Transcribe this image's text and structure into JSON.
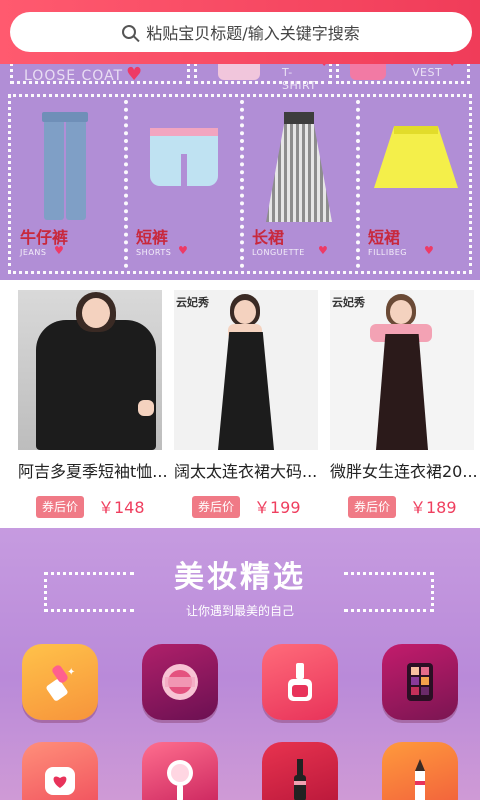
{
  "search": {
    "placeholder": "粘贴宝贝标题/输入关键字搜索"
  },
  "category_panel": {
    "top_items": [
      {
        "label": "LOOSE COAT"
      },
      {
        "label": "T-SHIRT"
      },
      {
        "label": "VEST"
      }
    ],
    "cells": [
      {
        "name": "牛仔裤",
        "en": "JEANS"
      },
      {
        "name": "短裤",
        "en": "SHORTS"
      },
      {
        "name": "长裙",
        "en": "LONGUETTE"
      },
      {
        "name": "短裙",
        "en": "FILLIBEG"
      }
    ]
  },
  "products": [
    {
      "title": "阿吉多夏季短袖t恤...",
      "badge": "券后价",
      "price": "￥148",
      "brand": ""
    },
    {
      "title": "阔太太连衣裙大码...",
      "badge": "券后价",
      "price": "￥199",
      "brand": "云妃秀"
    },
    {
      "title": "微胖女生连衣裙20...",
      "badge": "券后价",
      "price": "￥189",
      "brand": "云妃秀"
    }
  ],
  "beauty": {
    "title": "美妆精选",
    "subtitle": "让你遇到最美的自己",
    "icons": [
      {
        "icon": "lipstick-icon",
        "colors": [
          "#ffc24a",
          "#f7943b"
        ]
      },
      {
        "icon": "powder-compact-icon",
        "colors": [
          "#b0206a",
          "#6b1052"
        ]
      },
      {
        "icon": "nail-polish-icon",
        "colors": [
          "#ff6b7a",
          "#e8335a"
        ]
      },
      {
        "icon": "eyeshadow-palette-icon",
        "colors": [
          "#c31c6c",
          "#7a1552"
        ]
      },
      {
        "icon": "cream-jar-icon",
        "colors": [
          "#ff8f7a",
          "#ef4b5b"
        ]
      },
      {
        "icon": "mirror-icon",
        "colors": [
          "#ff6e8e",
          "#c41c58"
        ]
      },
      {
        "icon": "mascara-icon",
        "colors": [
          "#e8334f",
          "#b31438"
        ]
      },
      {
        "icon": "eyebrow-pencil-icon",
        "colors": [
          "#ff9a3c",
          "#f05a3c"
        ]
      }
    ]
  }
}
